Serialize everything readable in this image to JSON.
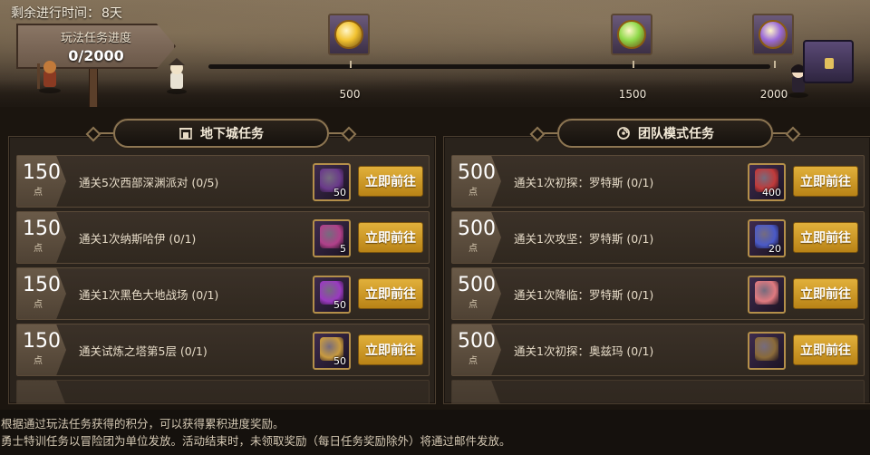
{
  "banner": {
    "remaining_label": "剩余进行时间：",
    "remaining_value": "8天",
    "signpost_title": "玩法任务进度",
    "signpost_progress": "0/2000",
    "progress": {
      "current": 0,
      "max": 2000
    },
    "milestones": [
      {
        "label": "500",
        "value": 500,
        "coin_color": "#f2c230"
      },
      {
        "label": "1500",
        "value": 1500,
        "coin_color": "#8fd94a"
      },
      {
        "label": "2000",
        "value": 2000,
        "coin_color": "#9a6ad8"
      }
    ]
  },
  "left_panel": {
    "title": "地下城任务",
    "icon": "dungeon-gate-icon",
    "tasks": [
      {
        "points": "150",
        "unit": "点",
        "name": "通关5次西部深渊派对 (0/5)",
        "reward_qty": "50",
        "reward_color": "#6a3a8a",
        "button": "立即前往"
      },
      {
        "points": "150",
        "unit": "点",
        "name": "通关1次纳斯哈伊 (0/1)",
        "reward_qty": "5",
        "reward_color": "#b0408a",
        "button": "立即前往"
      },
      {
        "points": "150",
        "unit": "点",
        "name": "通关1次黑色大地战场 (0/1)",
        "reward_qty": "50",
        "reward_color": "#9a3ac0",
        "button": "立即前往"
      },
      {
        "points": "150",
        "unit": "点",
        "name": "通关试炼之塔第5层 (0/1)",
        "reward_qty": "50",
        "reward_color": "#c89a40",
        "button": "立即前往"
      }
    ]
  },
  "right_panel": {
    "title": "团队模式任务",
    "icon": "team-swirl-icon",
    "tasks": [
      {
        "points": "500",
        "unit": "点",
        "name": "通关1次初探：罗特斯 (0/1)",
        "reward_qty": "400",
        "reward_color": "#c03a3a",
        "button": "立即前往"
      },
      {
        "points": "500",
        "unit": "点",
        "name": "通关1次攻坚：罗特斯 (0/1)",
        "reward_qty": "20",
        "reward_color": "#4a5ac8",
        "button": "立即前往"
      },
      {
        "points": "500",
        "unit": "点",
        "name": "通关1次降临：罗特斯 (0/1)",
        "reward_qty": "",
        "reward_color": "#e07a80",
        "button": "立即前往"
      },
      {
        "points": "500",
        "unit": "点",
        "name": "通关1次初探：奥兹玛 (0/1)",
        "reward_qty": "",
        "reward_color": "#8a6a3a",
        "button": "立即前往"
      }
    ]
  },
  "footer": {
    "line1": "根据通过玩法任务获得的积分，可以获得累积进度奖励。",
    "line2": "勇士特训任务以冒险团为单位发放。活动结束时，未领取奖励（每日任务奖励除外）将通过邮件发放。"
  }
}
